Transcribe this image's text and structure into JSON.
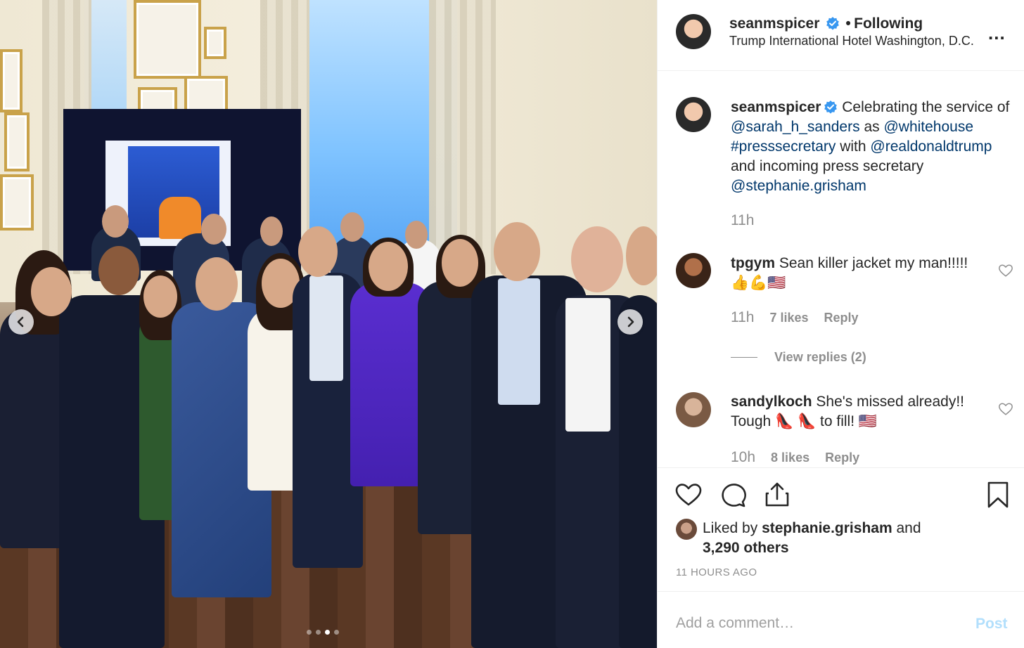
{
  "post": {
    "image_alt": "",
    "carousel": {
      "prev_icon": "chevron-left-icon",
      "next_icon": "chevron-right-icon",
      "slide_count": 4,
      "active_slide": 3
    }
  },
  "header": {
    "username": "seanmspicer",
    "verified": true,
    "separator": "•",
    "follow_status": "Following",
    "location": "Trump International Hotel Washington, D.C.",
    "more_label": "..."
  },
  "caption": {
    "username": "seanmspicer",
    "parts": [
      {
        "text": " Celebrating the service of ",
        "link": false
      },
      {
        "text": "@sarah_h_sanders",
        "link": true
      },
      {
        "text": " as ",
        "link": false
      },
      {
        "text": "@whitehouse",
        "link": true
      },
      {
        "text": " ",
        "link": false
      },
      {
        "text": "#presssecretary",
        "link": true
      },
      {
        "text": " with ",
        "link": false
      },
      {
        "text": "@realdonaldtrump",
        "link": true
      },
      {
        "text": " and incoming press secretary ",
        "link": false
      },
      {
        "text": "@stephanie.grisham",
        "link": true
      }
    ],
    "time": "11h"
  },
  "comments": [
    {
      "username": "tpgym",
      "text": "Sean killer jacket my man!!!!! 👍💪🇺🇸",
      "time": "11h",
      "likes": "7 likes",
      "reply_label": "Reply",
      "view_replies": "View replies (2)"
    },
    {
      "username": "sandylkoch",
      "text": "She's missed already!! Tough 👠 👠 to fill! 🇺🇸",
      "time": "10h",
      "likes": "8 likes",
      "reply_label": "Reply"
    }
  ],
  "actions": {
    "like_icon": "heart-icon",
    "comment_icon": "comment-icon",
    "share_icon": "share-icon",
    "save_icon": "bookmark-icon"
  },
  "likes": {
    "prefix": "Liked by ",
    "user": "stephanie.grisham",
    "suffix": " and",
    "others": "3,290 others"
  },
  "timestamp": "11 HOURS AGO",
  "add_comment": {
    "placeholder": "Add a comment…",
    "post_label": "Post"
  },
  "colors": {
    "link": "#00376b",
    "verified": "#3897f0",
    "muted": "#8e8e8e",
    "post_disabled": "#b2dffc"
  }
}
